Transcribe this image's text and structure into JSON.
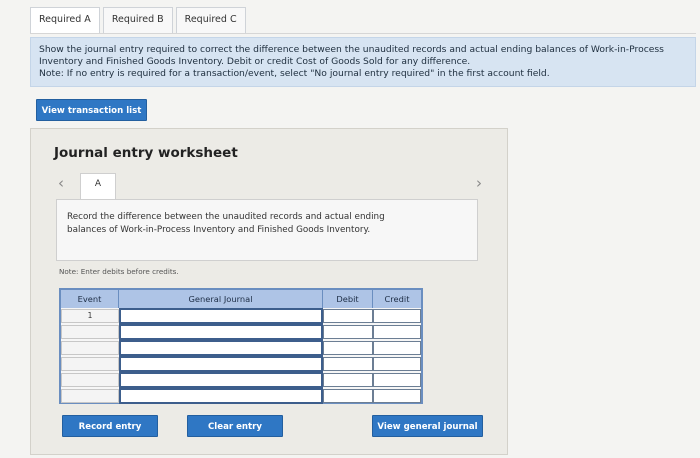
{
  "tabs": [
    {
      "label": "Required A"
    },
    {
      "label": "Required B"
    },
    {
      "label": "Required C"
    }
  ],
  "instructions": {
    "line1": "Show the journal entry required to correct the difference between the unaudited records and actual ending balances of Work-in-Process",
    "line2": "Inventory and Finished Goods Inventory. Debit or credit Cost of Goods Sold for any difference.",
    "line3": "Note: If no entry is required for a transaction/event, select \"No journal entry required\" in the first account field."
  },
  "buttons": {
    "view_transaction_list": "View transaction list",
    "record_entry": "Record entry",
    "clear_entry": "Clear entry",
    "view_general_journal": "View general journal"
  },
  "worksheet": {
    "title": "Journal entry worksheet",
    "event_tab": "A",
    "record_text_1": "Record the difference between the unaudited records and actual ending",
    "record_text_2": "balances of Work-in-Process Inventory and Finished Goods Inventory.",
    "note": "Note: Enter debits before credits."
  },
  "journal": {
    "headers": {
      "event": "Event",
      "general_journal": "General Journal",
      "debit": "Debit",
      "credit": "Credit"
    },
    "rows": [
      {
        "event": "1",
        "account": "",
        "debit": "",
        "credit": ""
      },
      {
        "event": "",
        "account": "",
        "debit": "",
        "credit": ""
      },
      {
        "event": "",
        "account": "",
        "debit": "",
        "credit": ""
      },
      {
        "event": "",
        "account": "",
        "debit": "",
        "credit": ""
      },
      {
        "event": "",
        "account": "",
        "debit": "",
        "credit": ""
      },
      {
        "event": "",
        "account": "",
        "debit": "",
        "credit": ""
      }
    ]
  },
  "colors": {
    "accent": "#2f77c4",
    "info_bg": "#d7e4f2",
    "table_header": "#aec4e6"
  }
}
